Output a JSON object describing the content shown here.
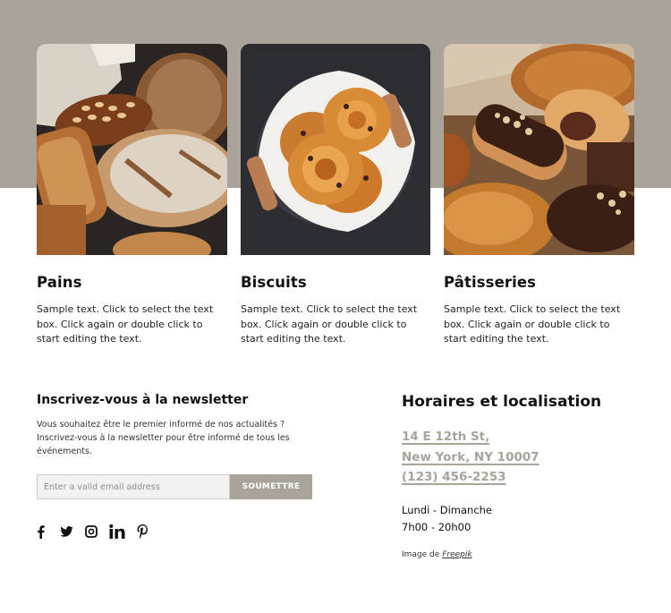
{
  "colors": {
    "band": "#a9a39a",
    "accent": "#a9a39a",
    "text": "#111111"
  },
  "cards": [
    {
      "image": "bread-loaves-image",
      "title": "Pains",
      "text": "Sample text. Click to select the text box. Click again or double click to start editing the text."
    },
    {
      "image": "brioche-rolls-image",
      "title": "Biscuits",
      "text": "Sample text. Click to select the text box. Click again or double click to start editing the text."
    },
    {
      "image": "pastries-eclairs-image",
      "title": "Pâtisseries",
      "text": "Sample text. Click to select the text box. Click again or double click to start editing the text."
    }
  ],
  "newsletter": {
    "title": "Inscrivez-vous à la newsletter",
    "text": "Vous souhaitez être le premier informé de nos actualités ? Inscrivez-vous à la newsletter pour être informé de tous les événements.",
    "email_placeholder": "Enter a valid email address",
    "email_value": "",
    "submit_label": "SOUMETTRE"
  },
  "social": [
    {
      "icon": "facebook-icon",
      "label": "Facebook"
    },
    {
      "icon": "twitter-icon",
      "label": "Twitter"
    },
    {
      "icon": "instagram-icon",
      "label": "Instagram"
    },
    {
      "icon": "linkedin-icon",
      "label": "LinkedIn"
    },
    {
      "icon": "pinterest-icon",
      "label": "Pinterest"
    }
  ],
  "hours": {
    "title": "Horaires et localisation",
    "address_line1": "14 E 12th St,",
    "address_line2": "New York, NY 10007",
    "phone": "(123) 456-2253",
    "days": "Lundi - Dimanche",
    "time": "7h00 - 20h00",
    "credit_prefix": "Image de",
    "credit_link": "Freepik"
  }
}
